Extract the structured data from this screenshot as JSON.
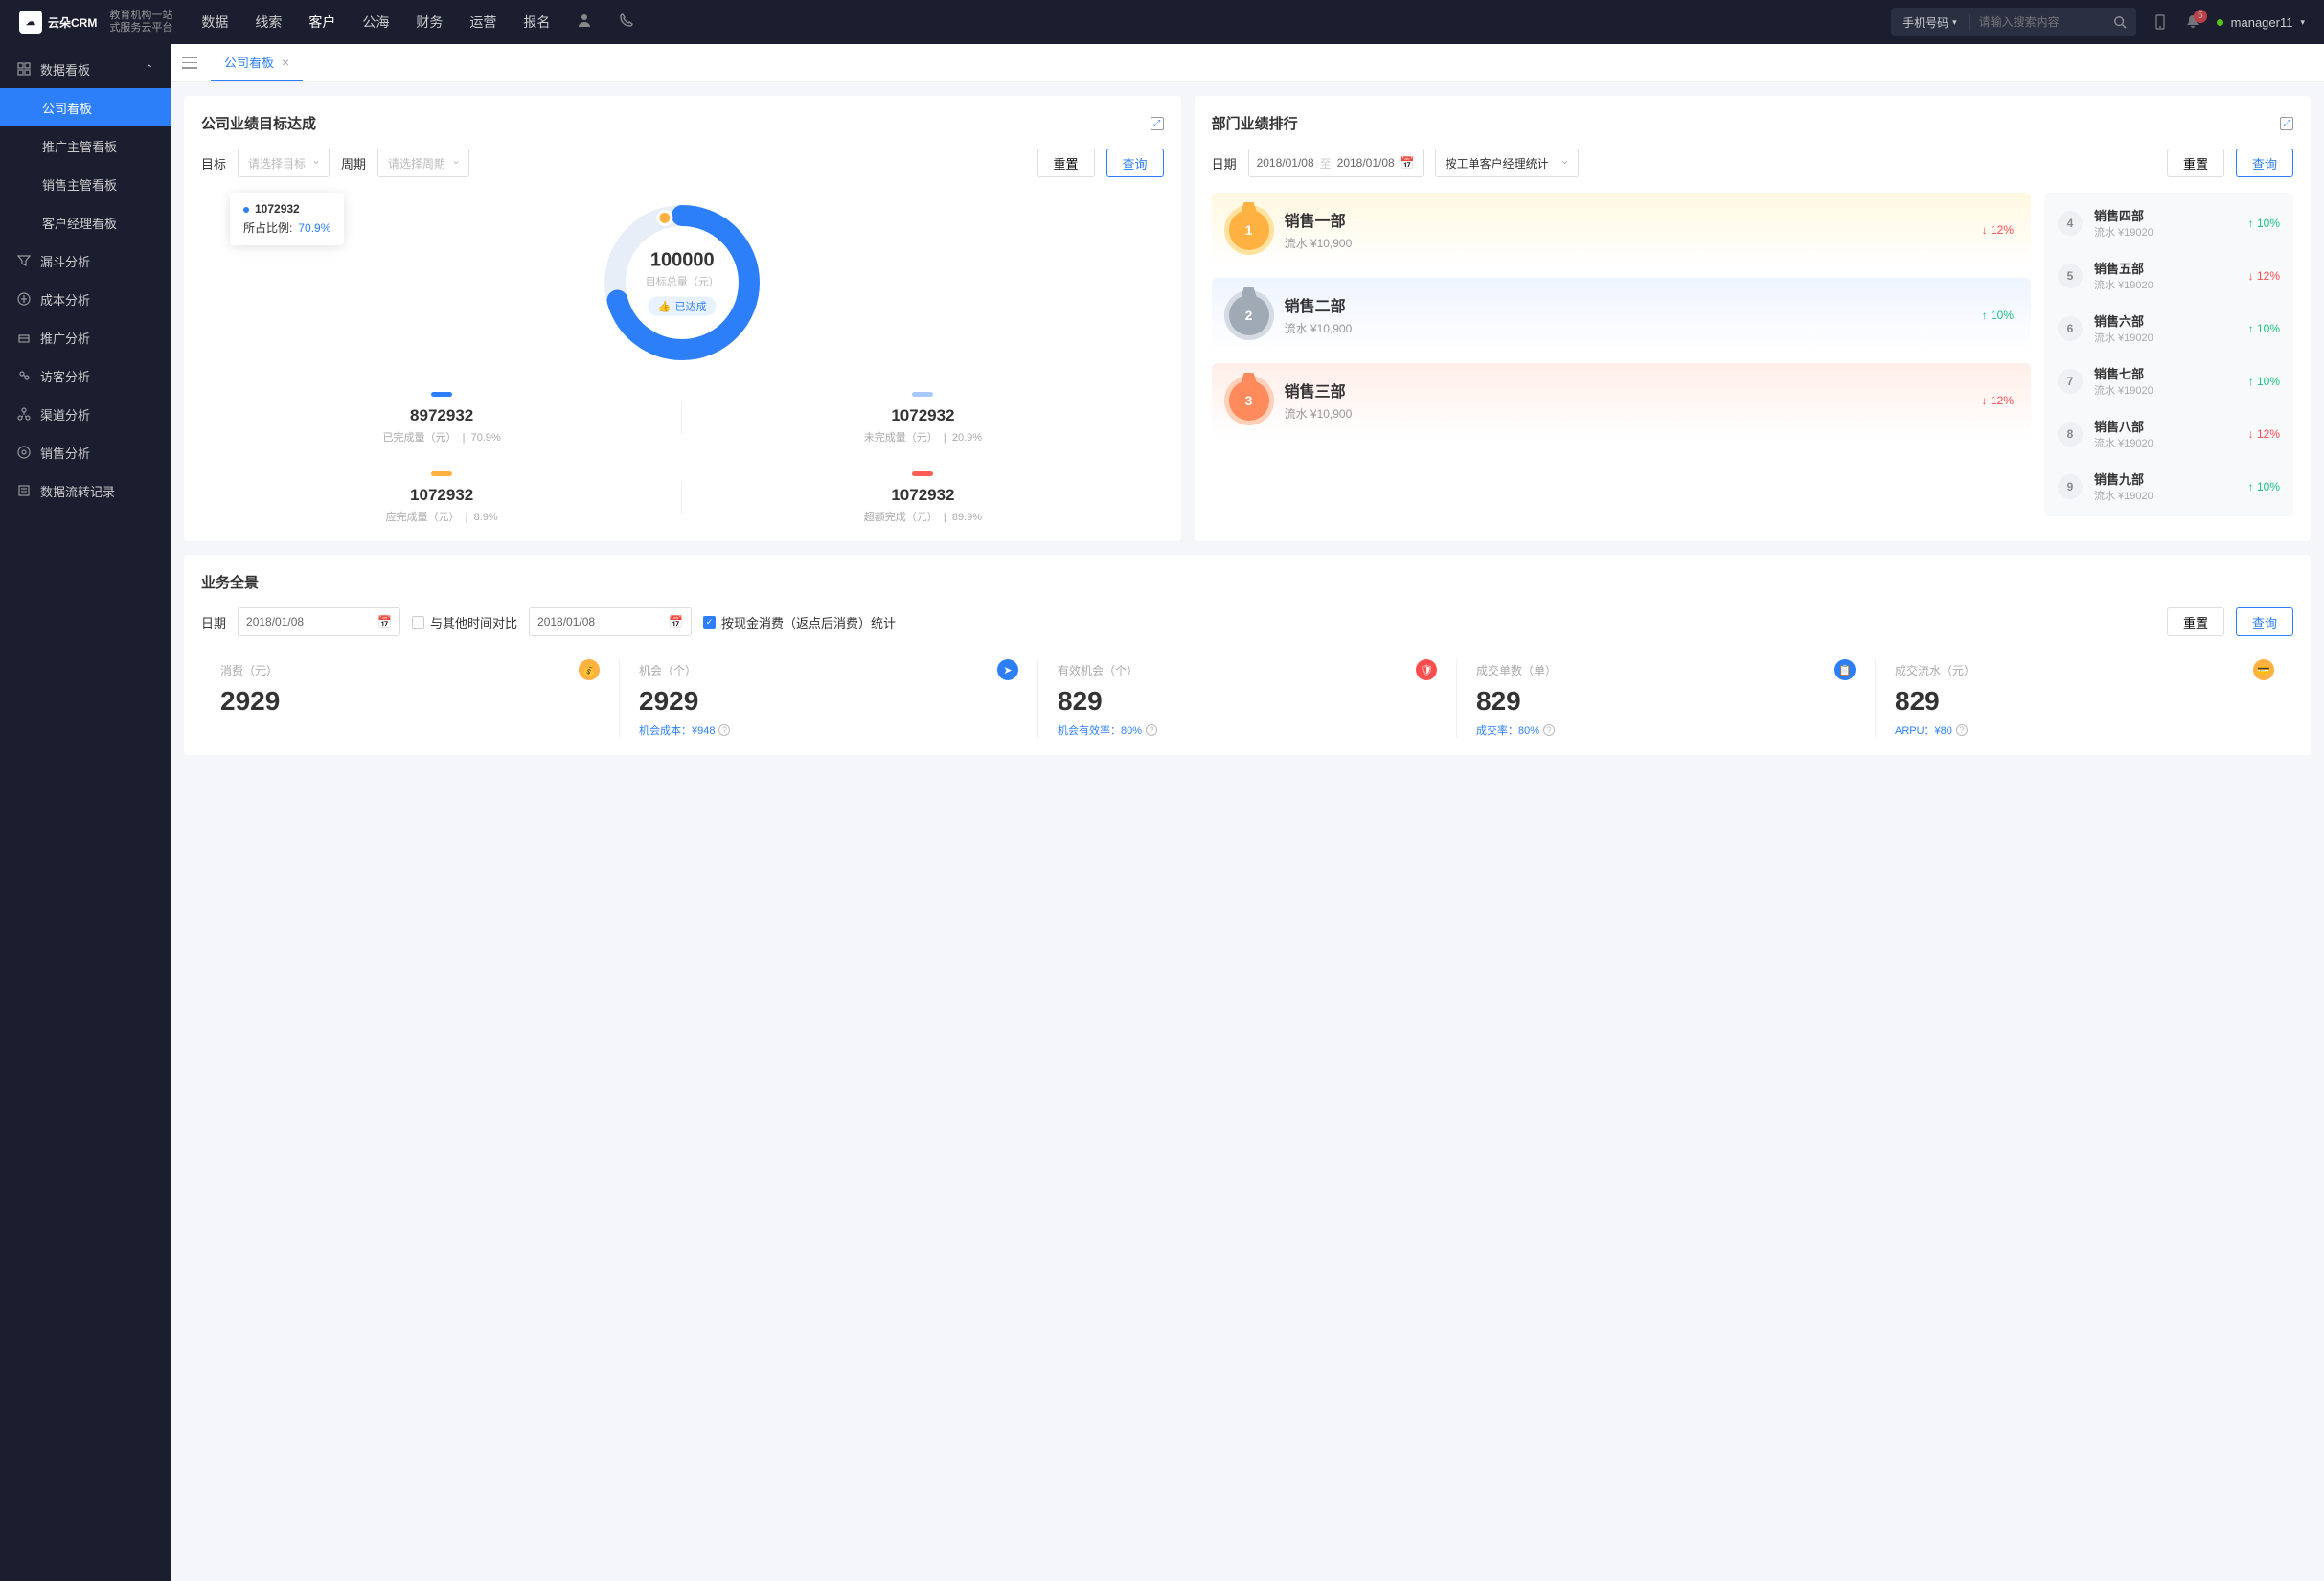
{
  "header": {
    "logo_main": "云朵CRM",
    "logo_sub1": "教育机构一站",
    "logo_sub2": "式服务云平台",
    "nav": [
      "数据",
      "线索",
      "客户",
      "公海",
      "财务",
      "运营",
      "报名"
    ],
    "nav_active": 2,
    "search_type": "手机号码",
    "search_placeholder": "请输入搜索内容",
    "notif_count": "5",
    "user": "manager11"
  },
  "sidebar": {
    "parent": "数据看板",
    "subs": [
      "公司看板",
      "推广主管看板",
      "销售主管看板",
      "客户经理看板"
    ],
    "active": 0,
    "items": [
      "漏斗分析",
      "成本分析",
      "推广分析",
      "访客分析",
      "渠道分析",
      "销售分析",
      "数据流转记录"
    ]
  },
  "tab": {
    "label": "公司看板"
  },
  "target": {
    "title": "公司业绩目标达成",
    "filters": {
      "target_label": "目标",
      "target_ph": "请选择目标",
      "period_label": "周期",
      "period_ph": "请选择周期",
      "reset": "重置",
      "query": "查询"
    },
    "tooltip": {
      "value": "1072932",
      "ratio_label": "所占比例:",
      "ratio": "70.9%"
    },
    "donut": {
      "value": "100000",
      "label": "目标总量（元）",
      "badge": "已达成",
      "pct": 70.9
    },
    "metrics": [
      {
        "value": "8972932",
        "label": "已完成量（元）",
        "pct": "70.9%"
      },
      {
        "value": "1072932",
        "label": "未完成量（元）",
        "pct": "20.9%"
      },
      {
        "value": "1072932",
        "label": "应完成量（元）",
        "pct": "8.9%"
      },
      {
        "value": "1072932",
        "label": "超额完成（元）",
        "pct": "89.9%"
      }
    ]
  },
  "ranking": {
    "title": "部门业绩排行",
    "filters": {
      "date_label": "日期",
      "from": "2018/01/08",
      "to_label": "至",
      "to": "2018/01/08",
      "stat": "按工单客户经理统计",
      "reset": "重置",
      "query": "查询"
    },
    "top3": [
      {
        "rank": "1",
        "name": "销售一部",
        "sub": "流水 ¥10,900",
        "pct": "12%",
        "dir": "down"
      },
      {
        "rank": "2",
        "name": "销售二部",
        "sub": "流水 ¥10,900",
        "pct": "10%",
        "dir": "up"
      },
      {
        "rank": "3",
        "name": "销售三部",
        "sub": "流水 ¥10,900",
        "pct": "12%",
        "dir": "down"
      }
    ],
    "rest": [
      {
        "rank": "4",
        "name": "销售四部",
        "sub": "流水 ¥19020",
        "pct": "10%",
        "dir": "up"
      },
      {
        "rank": "5",
        "name": "销售五部",
        "sub": "流水 ¥19020",
        "pct": "12%",
        "dir": "down"
      },
      {
        "rank": "6",
        "name": "销售六部",
        "sub": "流水 ¥19020",
        "pct": "10%",
        "dir": "up"
      },
      {
        "rank": "7",
        "name": "销售七部",
        "sub": "流水 ¥19020",
        "pct": "10%",
        "dir": "up"
      },
      {
        "rank": "8",
        "name": "销售八部",
        "sub": "流水 ¥19020",
        "pct": "12%",
        "dir": "down"
      },
      {
        "rank": "9",
        "name": "销售九部",
        "sub": "流水 ¥19020",
        "pct": "10%",
        "dir": "up"
      }
    ]
  },
  "overview": {
    "title": "业务全景",
    "date_label": "日期",
    "date1": "2018/01/08",
    "compare_label": "与其他时间对比",
    "date2": "2018/01/08",
    "check_label": "按现金消费（返点后消费）统计",
    "reset": "重置",
    "query": "查询",
    "stats": [
      {
        "label": "消费（元）",
        "value": "2929",
        "sub": ""
      },
      {
        "label": "机会（个）",
        "value": "2929",
        "sub": "机会成本：¥948"
      },
      {
        "label": "有效机会（个）",
        "value": "829",
        "sub": "机会有效率：80%"
      },
      {
        "label": "成交单数（单）",
        "value": "829",
        "sub": "成交率：80%"
      },
      {
        "label": "成交流水（元）",
        "value": "829",
        "sub": "ARPU：¥80"
      }
    ]
  },
  "chart_data": {
    "type": "pie",
    "title": "目标总量（元）",
    "total": 100000,
    "series": [
      {
        "name": "已达成",
        "value": 70.9
      },
      {
        "name": "未达成",
        "value": 29.1
      }
    ]
  }
}
